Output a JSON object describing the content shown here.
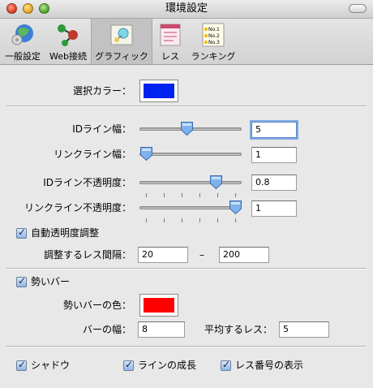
{
  "window": {
    "title": "環境設定"
  },
  "toolbar": {
    "items": [
      {
        "label": "一般設定",
        "icon": "general-settings-icon"
      },
      {
        "label": "Web接続",
        "icon": "web-connection-icon"
      },
      {
        "label": "グラフィック",
        "icon": "graphics-icon",
        "selected": true
      },
      {
        "label": "レス",
        "icon": "response-icon"
      },
      {
        "label": "ランキング",
        "icon": "ranking-icon"
      }
    ],
    "ranking_icon_lines": [
      "No.1",
      "No.2",
      "No.3"
    ]
  },
  "selection_color": {
    "label": "選択カラー：",
    "color": "#0022ee"
  },
  "id_line_width": {
    "label": "IDライン幅：",
    "value": "5",
    "slider_fraction": 0.45
  },
  "link_line_width": {
    "label": "リンクライン幅：",
    "value": "1",
    "slider_fraction": 0.0
  },
  "id_line_opacity": {
    "label": "IDライン不透明度：",
    "value": "0.8",
    "slider_fraction": 0.78
  },
  "link_line_opacity": {
    "label": "リンクライン不透明度：",
    "value": "1",
    "slider_fraction": 1.0
  },
  "auto_opacity": {
    "label": "自動透明度調整",
    "checked": true
  },
  "range": {
    "label": "調整するレス間隔：",
    "from": "20",
    "dash": "–",
    "to": "200"
  },
  "momentum_bar": {
    "label": "勢いバー",
    "checked": true
  },
  "bar_color": {
    "label": "勢いバーの色：",
    "color": "#ff0000"
  },
  "bar_width": {
    "label": "バーの幅：",
    "value": "8"
  },
  "average_res": {
    "label": "平均するレス：",
    "value": "5"
  },
  "bottom_options": [
    {
      "label": "シャドウ",
      "checked": true
    },
    {
      "label": "ラインの成長",
      "checked": true
    },
    {
      "label": "レス番号の表示",
      "checked": true
    }
  ]
}
